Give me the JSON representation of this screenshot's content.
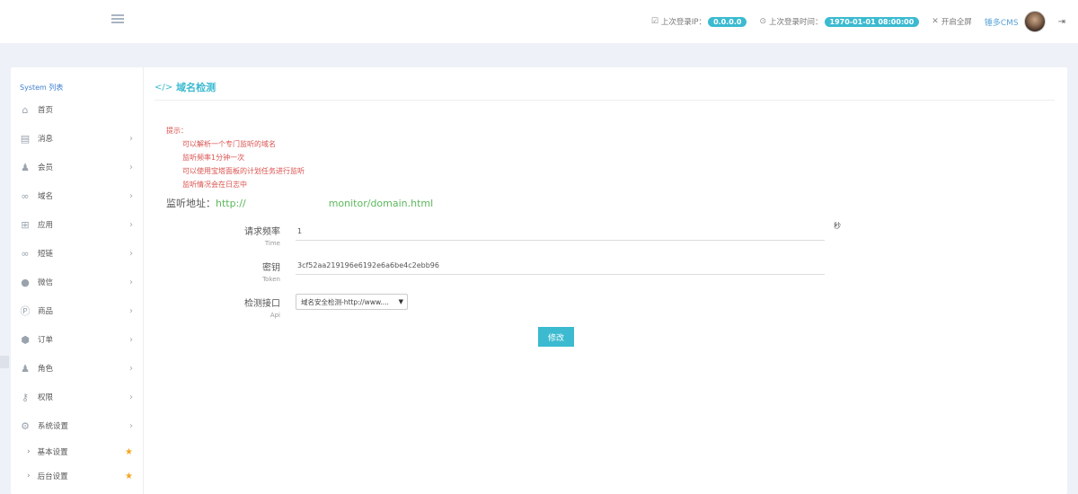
{
  "header": {
    "last_ip_label": "上次登录IP：",
    "last_ip_value": "0.0.0.0",
    "last_time_label": "上次登录时间：",
    "last_time_value": "1970-01-01 08:00:00",
    "fullscreen_label": "开启全屏",
    "brand": "锤多CMS"
  },
  "sidebar": {
    "title": "System 列表",
    "items": [
      {
        "label": "首页",
        "icon": "home-icon"
      },
      {
        "label": "消息",
        "icon": "file-icon"
      },
      {
        "label": "会员",
        "icon": "user-icon"
      },
      {
        "label": "域名",
        "icon": "link-icon"
      },
      {
        "label": "应用",
        "icon": "gift-icon"
      },
      {
        "label": "短链",
        "icon": "link-icon"
      },
      {
        "label": "微信",
        "icon": "wechat-icon"
      },
      {
        "label": "商品",
        "icon": "product-icon"
      },
      {
        "label": "订单",
        "icon": "order-icon"
      },
      {
        "label": "角色",
        "icon": "role-icon"
      },
      {
        "label": "权限",
        "icon": "key-icon"
      },
      {
        "label": "系统设置",
        "icon": "cogs-icon"
      }
    ],
    "subitems": [
      {
        "label": "基本设置"
      },
      {
        "label": "后台设置"
      }
    ]
  },
  "content": {
    "title": "域名检测",
    "tips_label": "提示：",
    "tips": [
      "可以解析一个专门监听的域名",
      "监听频率1分钟一次",
      "可以使用宝塔面板的计划任务进行监听",
      "监听情况会在日志中"
    ],
    "monitor_label": "监听地址：",
    "monitor_url_prefix": "http://",
    "monitor_url_suffix": "monitor/domain.html",
    "form": {
      "frequency_label": "请求频率",
      "frequency_sub": "Time",
      "frequency_value": "1",
      "frequency_unit": "秒",
      "token_label": "密钥",
      "token_sub": "Token",
      "token_value": "3cf52aa219196e6192e6a6be4c2ebb96",
      "api_label": "检测接口",
      "api_sub": "Api",
      "api_selected": "域名安全检测-http://www...."
    },
    "submit_label": "修改"
  },
  "colors": {
    "accent": "#3bbad0",
    "tip_red": "#d9534f",
    "url_green": "#5cb85c",
    "star": "#f5a623"
  }
}
